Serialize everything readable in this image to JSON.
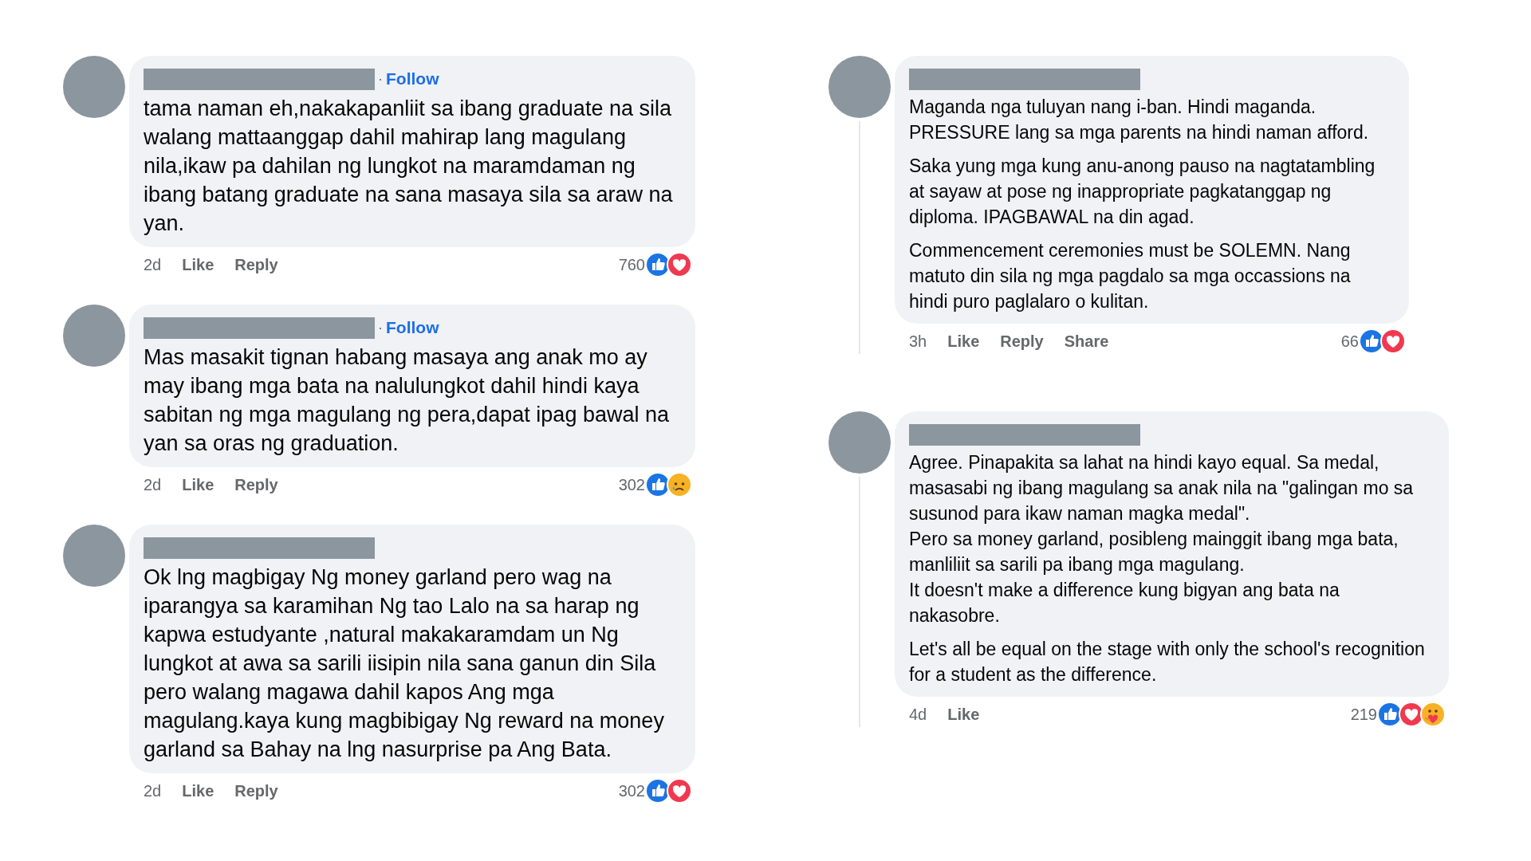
{
  "columns": [
    {
      "comments": [
        {
          "follow_separator": "·",
          "follow": "Follow",
          "thread_line": false,
          "paragraphs": [
            "tama naman eh,nakakapanliit sa ibang graduate na sila walang mattaanggap dahil mahirap lang magulang nila,ikaw pa dahilan ng lungkot na maramdaman ng ibang batang graduate na sana masaya sila sa araw na yan."
          ],
          "time": "2d",
          "actions": [
            "Like",
            "Reply"
          ],
          "count": "760",
          "reactions": [
            {
              "kind": "like"
            },
            {
              "kind": "love"
            }
          ]
        },
        {
          "follow_separator": "·",
          "follow": "Follow",
          "thread_line": false,
          "paragraphs": [
            "Mas masakit tignan habang masaya ang anak mo ay may ibang mga bata na nalulungkot dahil hindi kaya sabitan ng mga magulang ng pera,dapat ipag bawal na yan sa oras ng graduation."
          ],
          "time": "2d",
          "actions": [
            "Like",
            "Reply"
          ],
          "count": "302",
          "reactions": [
            {
              "kind": "like"
            },
            {
              "kind": "sad"
            }
          ]
        },
        {
          "thread_line": false,
          "paragraphs": [
            "Ok lng magbigay Ng money garland pero wag na iparangya sa karamihan Ng tao Lalo na sa harap ng kapwa estudyante ,natural makakaramdam un Ng lungkot at awa sa sarili iisipin nila sana ganun din Sila pero walang magawa dahil kapos Ang mga magulang.kaya kung magbibigay Ng reward na money garland sa Bahay na lng nasurprise pa Ang Bata."
          ],
          "time": "2d",
          "actions": [
            "Like",
            "Reply"
          ],
          "count": "302",
          "reactions": [
            {
              "kind": "like"
            },
            {
              "kind": "love"
            }
          ]
        }
      ]
    },
    {
      "comments": [
        {
          "thread_line": true,
          "paragraphs": [
            "Maganda nga tuluyan nang i-ban. Hindi maganda.\nPRESSURE lang sa mga parents na hindi naman afford.",
            "Saka yung mga kung anu-anong pauso na nagtatambling at sayaw at pose ng inappropriate pagkatanggap ng diploma. IPAGBAWAL na din agad.",
            "Commencement ceremonies must be SOLEMN. Nang matuto din sila ng mga pagdalo sa mga occassions na hindi puro paglalaro o kulitan."
          ],
          "time": "3h",
          "actions": [
            "Like",
            "Reply",
            "Share"
          ],
          "count": "66",
          "reactions": [
            {
              "kind": "like"
            },
            {
              "kind": "love"
            }
          ]
        },
        {
          "thread_line": true,
          "paragraphs": [
            "Agree. Pinapakita sa lahat na hindi kayo equal. Sa medal, masasabi ng ibang magulang sa anak nila na \"galingan mo sa susunod para ikaw naman magka medal\".\nPero sa money garland, posibleng mainggit ibang mga bata, manliliit sa sarili pa ibang mga magulang.\nIt doesn't make a difference kung bigyan ang bata na nakasobre.",
            "Let's all be equal on the stage with only the school's recognition for a student as the difference."
          ],
          "time": "4d",
          "actions": [
            "Like"
          ],
          "count": "219",
          "reactions": [
            {
              "kind": "like"
            },
            {
              "kind": "love"
            },
            {
              "kind": "care"
            }
          ]
        }
      ]
    }
  ]
}
